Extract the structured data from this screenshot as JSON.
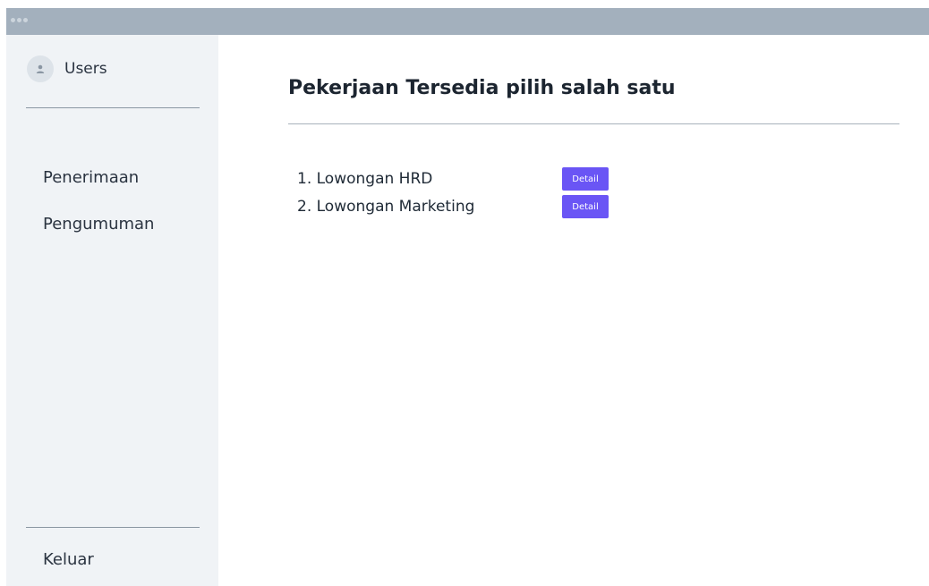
{
  "sidebar": {
    "user_label": "Users",
    "nav": [
      {
        "label": "Penerimaan"
      },
      {
        "label": "Pengumuman"
      }
    ],
    "logout_label": "Keluar"
  },
  "main": {
    "title": "Pekerjaan Tersedia pilih salah satu",
    "jobs": [
      {
        "label": "1. Lowongan HRD",
        "button": "Detail"
      },
      {
        "label": "2. Lowongan Marketing",
        "button": "Detail"
      }
    ]
  },
  "icons": {
    "avatar": "user-icon"
  },
  "colors": {
    "titlebar": "#a3b0bd",
    "sidebar": "#f0f3f6",
    "accent": "#6a55f5"
  }
}
